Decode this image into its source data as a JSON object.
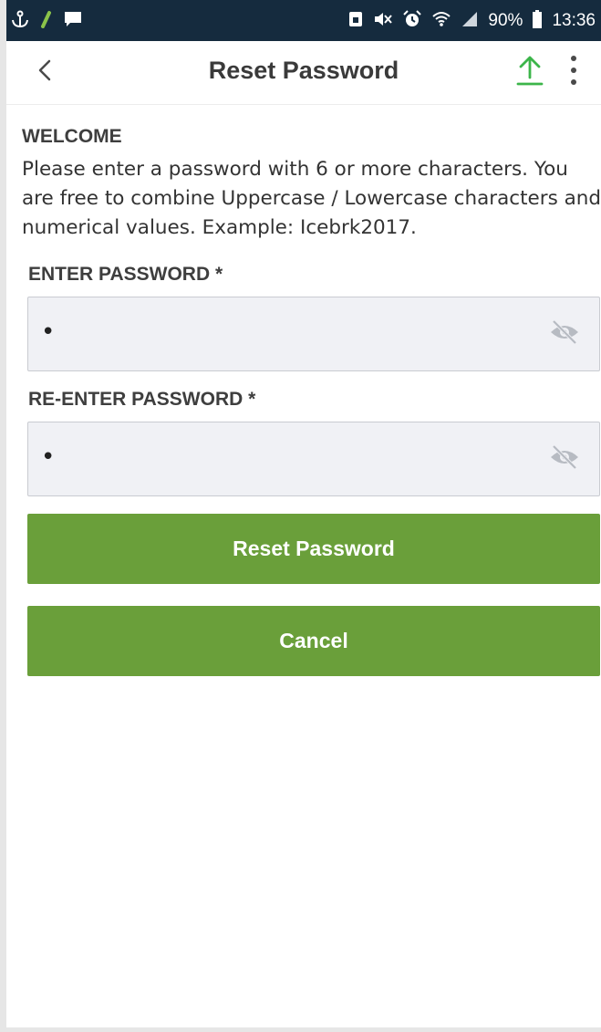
{
  "status_bar": {
    "battery_percent": "90%",
    "time": "13:36",
    "icons": [
      "anchor-icon",
      "leaf-icon",
      "chat-icon",
      "sim-icon",
      "mute-icon",
      "alarm-icon",
      "wifi-icon",
      "signal-icon",
      "battery-icon"
    ]
  },
  "app_bar": {
    "title": "Reset Password",
    "icons": [
      "back-chevron-icon",
      "upload-icon",
      "more-vertical-icon"
    ]
  },
  "content": {
    "welcome_heading": "WELCOME",
    "welcome_text": "Please enter a password with 6 or more characters. You are free to combine Uppercase / Lowercase characters and numerical values. Example: Icebrk2017.",
    "password_label": "ENTER PASSWORD *",
    "password_value": "•",
    "confirm_label": "RE-ENTER PASSWORD *",
    "confirm_value": "•",
    "reset_button_label": "Reset Password",
    "cancel_button_label": "Cancel"
  },
  "colors": {
    "status_bar": "#152b3e",
    "primary_green": "#6a9f3a",
    "upload_icon": "#3cb54a",
    "field_bg": "#f0f1f5"
  }
}
